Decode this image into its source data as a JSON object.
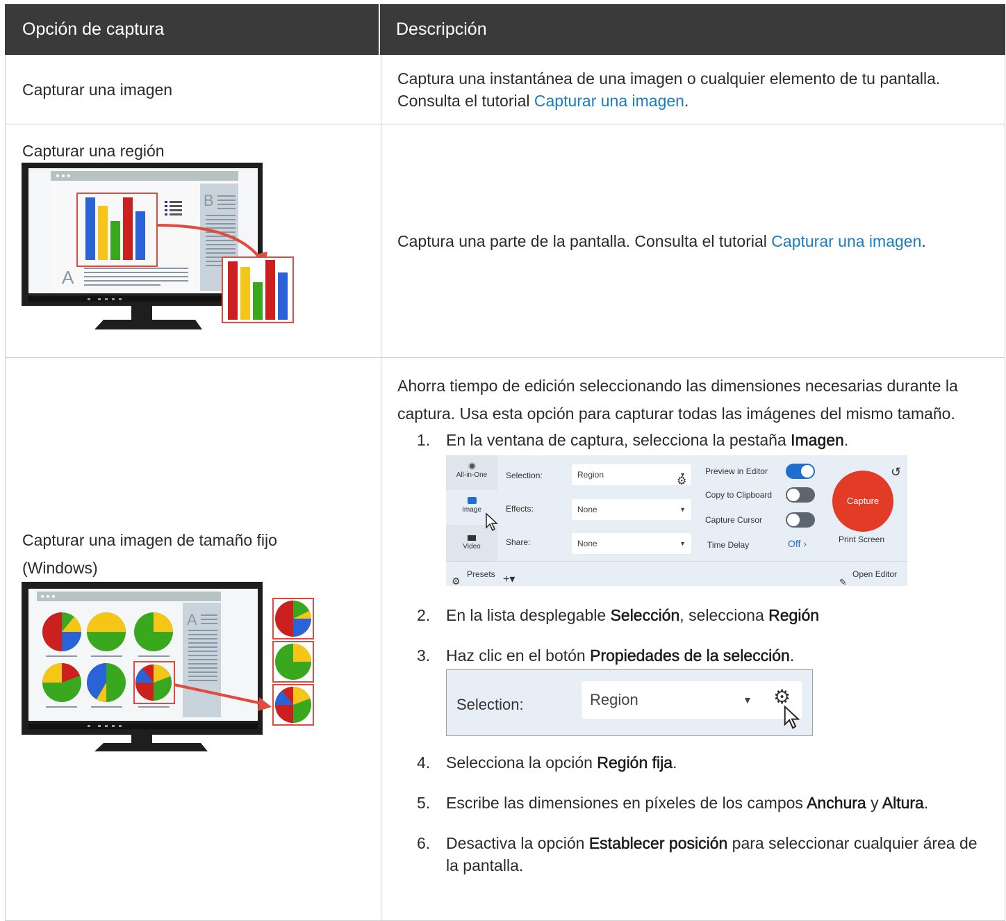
{
  "table": {
    "headers": [
      "Opción de captura",
      "Descripción"
    ],
    "rows": [
      {
        "option": "Capturar una imagen",
        "desc_before": "Captura una instantánea de una imagen o cualquier elemento de tu pantalla. Consulta el tutorial ",
        "desc_link": "Capturar una imagen",
        "desc_after": "."
      },
      {
        "option": "Capturar una región",
        "desc_before": "Captura una parte de la pantalla. Consulta el tutorial ",
        "desc_link": "Capturar una imagen",
        "desc_after": "."
      },
      {
        "option": "Capturar una imagen de tamaño fijo (Windows)",
        "intro": "Ahorra tiempo de edición seleccionando las dimensiones necesarias durante la captura. Usa esta opción para capturar todas las imágenes del mismo tamaño."
      }
    ]
  },
  "steps": {
    "s1": {
      "num": "1.",
      "before": "En la ventana de captura, selecciona la pestaña ",
      "b1": "Imagen",
      "after": "."
    },
    "s2": {
      "num": "2.",
      "before": "En la lista desplegable ",
      "b1": "Selección",
      "mid": ", selecciona ",
      "b2": "Región"
    },
    "s3": {
      "num": "3.",
      "before": "Haz clic en el botón ",
      "b1": "Propiedades de la selección",
      "after": "."
    },
    "s4": {
      "num": "4.",
      "before": "Selecciona la opción ",
      "b1": "Región fija",
      "after": "."
    },
    "s5": {
      "num": "5.",
      "before": "Escribe las dimensiones en píxeles de los campos ",
      "b1": "Anchura",
      "mid": " y ",
      "b2": "Altura",
      "after": "."
    },
    "s6": {
      "num": "6.",
      "before": "Desactiva la opción ",
      "b1": "Establecer posición",
      "after": " para seleccionar cualquier área de la pantalla."
    }
  },
  "snagit": {
    "tabs": [
      "All-in-One",
      "Image",
      "Video"
    ],
    "selection_label": "Selection:",
    "selection_value": "Region",
    "effects_label": "Effects:",
    "effects_value": "None",
    "share_label": "Share:",
    "share_value": "None",
    "preview_label": "Preview in Editor",
    "clipboard_label": "Copy to Clipboard",
    "cursor_label": "Capture Cursor",
    "delay_label": "Time Delay",
    "delay_value": "Off",
    "capture_label": "Capture",
    "print_screen": "Print Screen",
    "presets_label": "Presets",
    "open_editor": "Open Editor",
    "toggles": {
      "preview": true,
      "clipboard": false,
      "cursor": false
    }
  },
  "selection_zoom": {
    "label": "Selection:",
    "value": "Region"
  },
  "colors": {
    "header_bg": "#3a3a3a",
    "link": "#1a7cc4",
    "capture_red": "#e23b26",
    "toggle_on": "#1f6fd1",
    "chart_red": "#cc1f1f",
    "chart_blue": "#2a63d8",
    "chart_yellow": "#f5c518",
    "chart_green": "#3aa81f"
  }
}
